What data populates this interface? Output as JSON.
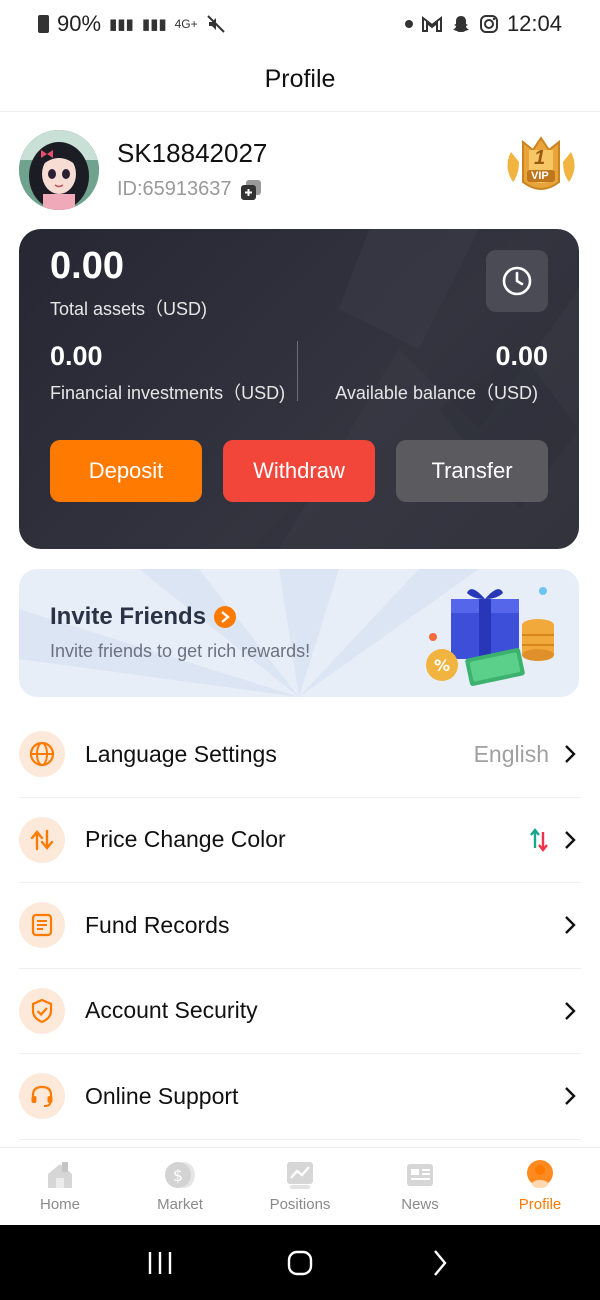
{
  "status_bar": {
    "battery": "90%",
    "network": "4G+",
    "time": "12:04"
  },
  "header": {
    "title": "Profile"
  },
  "profile": {
    "username": "SK18842027",
    "user_id": "ID:65913637",
    "vip_level": "1",
    "vip_text": "VIP"
  },
  "assets": {
    "total_value": "0.00",
    "total_label": "Total assets（USD)",
    "financial_value": "0.00",
    "financial_label": "Financial investments（USD)",
    "available_value": "0.00",
    "available_label": "Available balance（USD)",
    "buttons": {
      "deposit": "Deposit",
      "withdraw": "Withdraw",
      "transfer": "Transfer"
    }
  },
  "invite": {
    "title": "Invite Friends",
    "subtitle": "Invite friends to get rich rewards!"
  },
  "menu": [
    {
      "label": "Language Settings",
      "value": "English",
      "icon": "globe-icon"
    },
    {
      "label": "Price Change Color",
      "value": "",
      "icon": "swap-icon"
    },
    {
      "label": "Fund Records",
      "value": "",
      "icon": "document-icon"
    },
    {
      "label": "Account Security",
      "value": "",
      "icon": "shield-check-icon"
    },
    {
      "label": "Online Support",
      "value": "",
      "icon": "headset-icon"
    }
  ],
  "bottom_nav": [
    {
      "label": "Home",
      "icon": "home-icon",
      "active": false
    },
    {
      "label": "Market",
      "icon": "dollar-icon",
      "active": false
    },
    {
      "label": "Positions",
      "icon": "chart-icon",
      "active": false
    },
    {
      "label": "News",
      "icon": "news-icon",
      "active": false
    },
    {
      "label": "Profile",
      "icon": "profile-icon",
      "active": true
    }
  ],
  "colors": {
    "accent": "#ff7a00",
    "withdraw": "#f3463b",
    "transfer": "#5b5b5f",
    "card_bg": "#2a2b35",
    "price_up": "#1aa58c",
    "price_down": "#f0334a"
  }
}
